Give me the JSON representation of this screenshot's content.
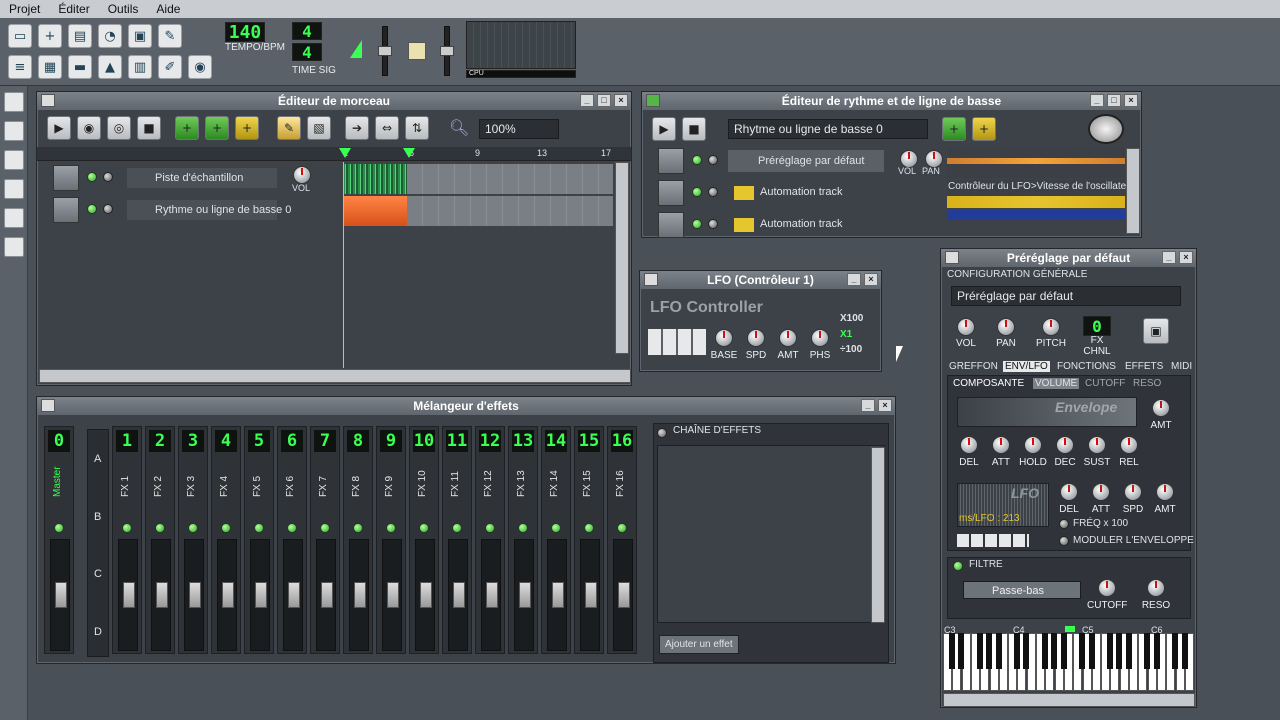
{
  "menu": [
    "Projet",
    "Éditer",
    "Outils",
    "Aide"
  ],
  "toolbar": {
    "tempo": "140",
    "tempo_label": "TEMPO/BPM",
    "timesig_top": "4",
    "timesig_bottom": "4",
    "timesig_label": "TIME SIG",
    "cpu_label": "CPU"
  },
  "song_editor": {
    "title": "Éditeur de morceau",
    "zoom": "100%",
    "ruler": [
      "1",
      "5",
      "9",
      "13",
      "17"
    ],
    "tracks": [
      {
        "name": "Piste d'échantillon"
      },
      {
        "name": "Rythme ou ligne de basse 0"
      }
    ],
    "vol_label": "VOL"
  },
  "beat_editor": {
    "title": "Éditeur de rythme et de ligne de basse",
    "selector": "Rhytme ou ligne de basse 0",
    "tracks": [
      {
        "name": "Préréglage par défaut"
      },
      {
        "name": "Automation track"
      },
      {
        "name": "Automation track"
      }
    ],
    "vol_label": "VOL",
    "pan_label": "PAN",
    "lfo_link": "Contrôleur du LFO>Vitesse de l'oscillate"
  },
  "lfo": {
    "title": "LFO (Contrôleur 1)",
    "heading": "LFO Controller",
    "knobs": [
      "BASE",
      "SPD",
      "AMT",
      "PHS"
    ],
    "mult": [
      "X100",
      "X1",
      "÷100"
    ]
  },
  "mixer": {
    "title": "Mélangeur d'effets",
    "master": {
      "num": "0",
      "label": "Master"
    },
    "channels": [
      {
        "num": "1",
        "label": "FX 1"
      },
      {
        "num": "2",
        "label": "FX 2"
      },
      {
        "num": "3",
        "label": "FX 3"
      },
      {
        "num": "4",
        "label": "FX 4"
      },
      {
        "num": "5",
        "label": "FX 5"
      },
      {
        "num": "6",
        "label": "FX 6"
      },
      {
        "num": "7",
        "label": "FX 7"
      },
      {
        "num": "8",
        "label": "FX 8"
      },
      {
        "num": "9",
        "label": "FX 9"
      },
      {
        "num": "10",
        "label": "FX 10"
      },
      {
        "num": "11",
        "label": "FX 11"
      },
      {
        "num": "12",
        "label": "FX 12"
      },
      {
        "num": "13",
        "label": "FX 13"
      },
      {
        "num": "14",
        "label": "FX 14"
      },
      {
        "num": "15",
        "label": "FX 15"
      },
      {
        "num": "16",
        "label": "FX 16"
      }
    ],
    "banks": [
      "A",
      "B",
      "C",
      "D"
    ],
    "chain_label": "CHAÎNE D'EFFETS",
    "add_effect": "Ajouter un effet"
  },
  "preset": {
    "title": "Préréglage par défaut",
    "config_label": "CONFIGURATION GÉNÉRALE",
    "name": "Préréglage par défaut",
    "knobs": [
      "VOL",
      "PAN",
      "PITCH"
    ],
    "fxch_num": "0",
    "fxch_label": "FX CHNL",
    "tabs": [
      "GREFFON",
      "ENV/LFO",
      "FONCTIONS",
      "EFFETS",
      "MIDI"
    ],
    "subtabs": [
      "COMPOSANTE",
      "VOLUME",
      "CUTOFF",
      "RESO"
    ],
    "env_label": "Envelope",
    "amt_label": "AMT",
    "env_knobs": [
      "DEL",
      "ATT",
      "HOLD",
      "DEC",
      "SUST",
      "REL"
    ],
    "lfo_label": "LFO",
    "lfo_readout": "ms/LFO : 213",
    "lfo_knobs": [
      "DEL",
      "ATT",
      "SPD",
      "AMT"
    ],
    "freq_label": "FRÉQ x 100",
    "mod_label": "MODULER L'ENVELOPPE",
    "filter_label": "FILTRE",
    "filter_type": "Passe-bas",
    "filter_knobs": [
      "CUTOFF",
      "RESO"
    ],
    "octaves": [
      "C3",
      "C4",
      "C5",
      "C6"
    ]
  }
}
